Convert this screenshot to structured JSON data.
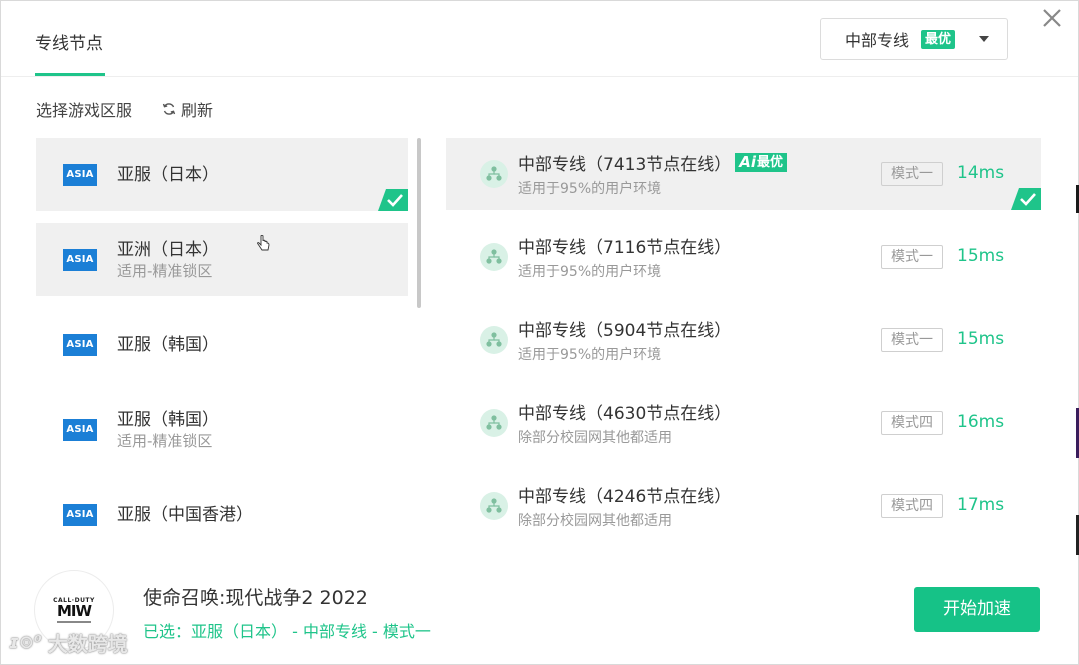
{
  "header": {
    "tab_title": "专线节点",
    "line_select": {
      "label": "中部专线",
      "badge": "最优"
    }
  },
  "toolbar": {
    "region_label": "选择游戏区服",
    "refresh_label": "刷新"
  },
  "regions": [
    {
      "logo": "ASIA",
      "name": "亚服（日本）",
      "sub": "",
      "state": "selected"
    },
    {
      "logo": "ASIA",
      "name": "亚洲（日本）",
      "sub": "适用-精准锁区",
      "state": "hovered"
    },
    {
      "logo": "ASIA",
      "name": "亚服（韩国）",
      "sub": "",
      "state": ""
    },
    {
      "logo": "ASIA",
      "name": "亚服（韩国）",
      "sub": "适用-精准锁区",
      "state": ""
    },
    {
      "logo": "ASIA",
      "name": "亚服（中国香港）",
      "sub": "",
      "state": ""
    }
  ],
  "nodes": [
    {
      "title": "中部专线（7413节点在线）",
      "badge": "最优",
      "badge_ai": "Ai",
      "desc": "适用于95%的用户环境",
      "mode": "模式一",
      "latency": "14ms",
      "state": "selected"
    },
    {
      "title": "中部专线（7116节点在线）",
      "desc": "适用于95%的用户环境",
      "mode": "模式一",
      "latency": "15ms",
      "state": ""
    },
    {
      "title": "中部专线（5904节点在线）",
      "desc": "适用于95%的用户环境",
      "mode": "模式一",
      "latency": "15ms",
      "state": ""
    },
    {
      "title": "中部专线（4630节点在线）",
      "desc": "除部分校园网其他都适用",
      "mode": "模式四",
      "latency": "16ms",
      "state": ""
    },
    {
      "title": "中部专线（4246节点在线）",
      "desc": "除部分校园网其他都适用",
      "mode": "模式四",
      "latency": "17ms",
      "state": ""
    }
  ],
  "footer": {
    "game_logo_top": "CALL·DUTY",
    "game_logo_main": "MIW",
    "game_title": "使命召唤:现代战争2 2022",
    "selected_info": "已选：亚服（日本） - 中部专线 - 模式一",
    "start_button": "开始加速"
  },
  "watermark": {
    "logo": "ɪ⊙⁰",
    "text": "大数跨境"
  },
  "colors": {
    "accent": "#1fc48a",
    "asia_logo": "#1b7fd6"
  }
}
